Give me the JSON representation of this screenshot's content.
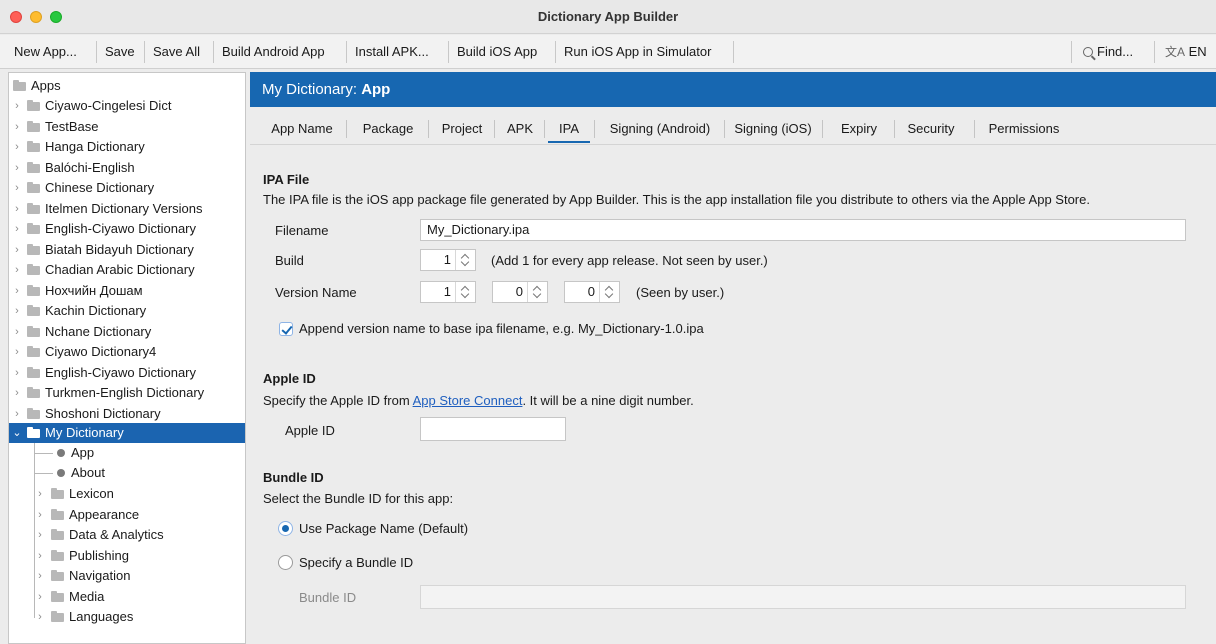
{
  "window": {
    "title": "Dictionary App Builder"
  },
  "toolbar": {
    "new_app": "New App...",
    "save": "Save",
    "save_all": "Save All",
    "build_android": "Build Android App",
    "install_apk": "Install APK...",
    "build_ios": "Build iOS App",
    "run_ios": "Run iOS App in Simulator",
    "find": "Find...",
    "language": "EN"
  },
  "sidebar": {
    "root": "Apps",
    "apps": [
      "Ciyawo-Cingelesi Dict",
      "TestBase",
      "Hanga Dictionary",
      "Balóchi-English",
      "Chinese Dictionary",
      "Itelmen Dictionary Versions",
      "English-Ciyawo Dictionary",
      "Biatah Bidayuh Dictionary",
      "Chadian Arabic Dictionary",
      "Нохчийн Дошам",
      "Kachin Dictionary",
      "Nchane Dictionary",
      "Ciyawo Dictionary4",
      "English-Ciyawo Dictionary",
      "Turkmen-English Dictionary",
      "Shoshoni Dictionary"
    ],
    "selected": "My Dictionary",
    "leaf_children": [
      "App",
      "About"
    ],
    "folder_children": [
      "Lexicon",
      "Appearance",
      "Data & Analytics",
      "Publishing",
      "Navigation",
      "Media",
      "Languages"
    ]
  },
  "header": {
    "prefix": "My Dictionary: ",
    "section": "App"
  },
  "tabs": [
    "App Name",
    "Package",
    "Project",
    "APK",
    "IPA",
    "Signing (Android)",
    "Signing (iOS)",
    "Expiry",
    "Security",
    "Permissions"
  ],
  "active_tab": "IPA",
  "ipa": {
    "title": "IPA File",
    "description": "The IPA file is the iOS app package file generated by App Builder. This is the app installation file you distribute to others via the Apple App Store.",
    "filename_label": "Filename",
    "filename_value": "My_Dictionary.ipa",
    "build_label": "Build",
    "build_value": "1",
    "build_hint": "(Add 1 for every app release. Not seen by user.)",
    "version_label": "Version Name",
    "version_major": "1",
    "version_minor": "0",
    "version_patch": "0",
    "version_hint": "(Seen by user.)",
    "append_label": "Append version name to base ipa filename, e.g. My_Dictionary-1.0.ipa",
    "append_checked": true
  },
  "apple": {
    "title": "Apple ID",
    "desc_before": "Specify the Apple ID from ",
    "link": "App Store Connect",
    "desc_after": ". It will be a nine digit number.",
    "field_label": "Apple ID",
    "field_value": ""
  },
  "bundle": {
    "title": "Bundle ID",
    "description": "Select the Bundle ID for this app:",
    "option_package": "Use Package Name (Default)",
    "option_specify": "Specify a Bundle ID",
    "selected_option": "Use Package Name (Default)",
    "field_label": "Bundle ID",
    "field_value": ""
  },
  "colors": {
    "accent": "#1767b1",
    "selection": "#1b64b0",
    "link": "#1f5fbf"
  }
}
